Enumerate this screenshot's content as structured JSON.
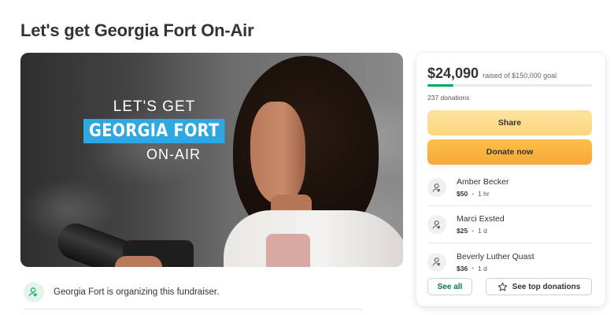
{
  "page": {
    "title": "Let's get Georgia Fort On-Air"
  },
  "hero": {
    "line1": "LET'S GET",
    "line2": "GEORGIA FORT",
    "line3": "ON-AIR"
  },
  "organizer": {
    "text": "Georgia Fort is organizing this fundraiser.",
    "icon": "user-heart-icon"
  },
  "donation_card": {
    "amount": "$24,090",
    "goal_text": "raised of $150,000 goal",
    "progress_fraction": 0.16,
    "donation_count": "237 donations",
    "share_label": "Share",
    "donate_label": "Donate now",
    "donors": [
      {
        "name": "Amber Becker",
        "amount": "$50",
        "time": "1 hr"
      },
      {
        "name": "Marci Exsted",
        "amount": "$25",
        "time": "1 d"
      },
      {
        "name": "Beverly Luther Quast",
        "amount": "$36",
        "time": "1 d"
      }
    ],
    "see_all_label": "See all",
    "top_donations_label": "See top donations"
  },
  "colors": {
    "brand_green": "#02a95c",
    "share_yellow": "#fcd57e",
    "donate_orange": "#f7a83a",
    "hero_banner_blue": "#2fa7e0"
  }
}
